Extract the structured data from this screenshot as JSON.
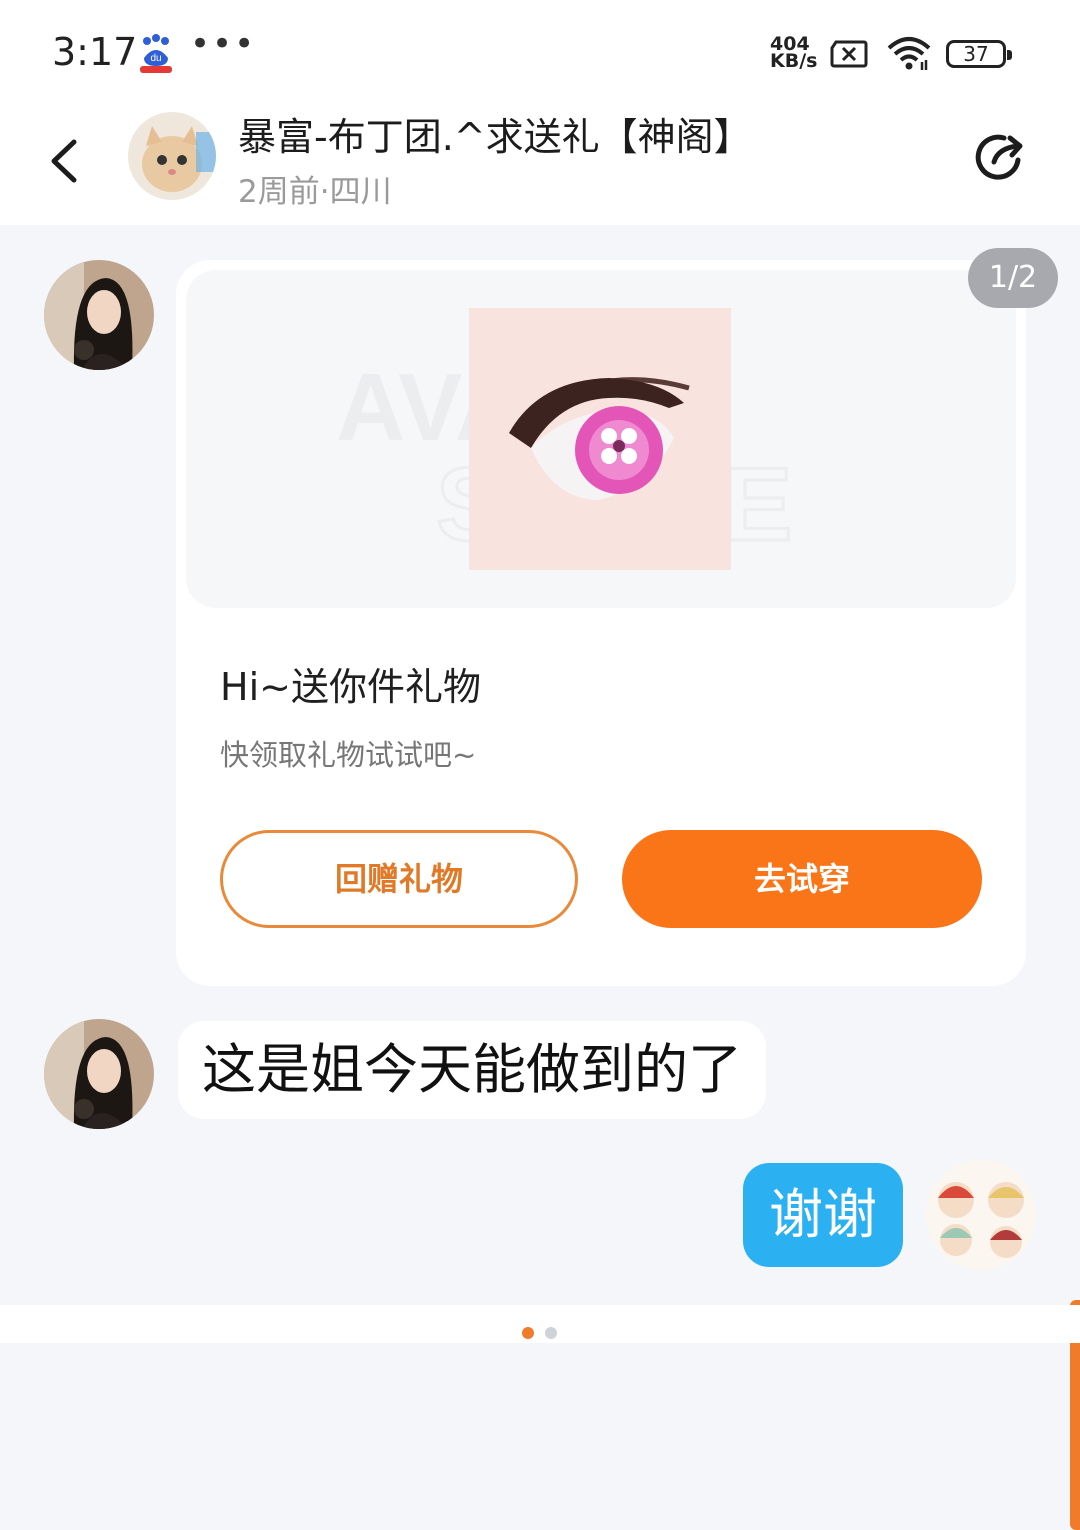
{
  "status_bar": {
    "time": "3:17",
    "speed_value": "404",
    "speed_unit": "KB/s",
    "battery": "37",
    "icons": [
      "baidu-app-icon",
      "more-dots-icon",
      "sim-no-signal-icon",
      "wifi-icon",
      "battery-icon"
    ]
  },
  "header": {
    "title": "暴富-布丁团.^求送礼【神阁】",
    "subtitle": "2周前·四川",
    "back_icon": "chevron-left-icon",
    "share_icon": "share-icon"
  },
  "messages": {
    "gift_card": {
      "page_indicator": "1/2",
      "title": "Hi~送你件礼物",
      "subtitle": "快领取礼物试试吧~",
      "return_button": "回赠礼物",
      "try_button": "去试穿",
      "watermark_text": "AVATAR STORE"
    },
    "text_message": "这是姐今天能做到的了",
    "my_reply": "谢谢"
  },
  "colors": {
    "accent_orange": "#fa7418",
    "reply_blue": "#2bb0f2",
    "background": "#f4f6f9"
  },
  "pager": {
    "dots": 2,
    "active": 0
  }
}
